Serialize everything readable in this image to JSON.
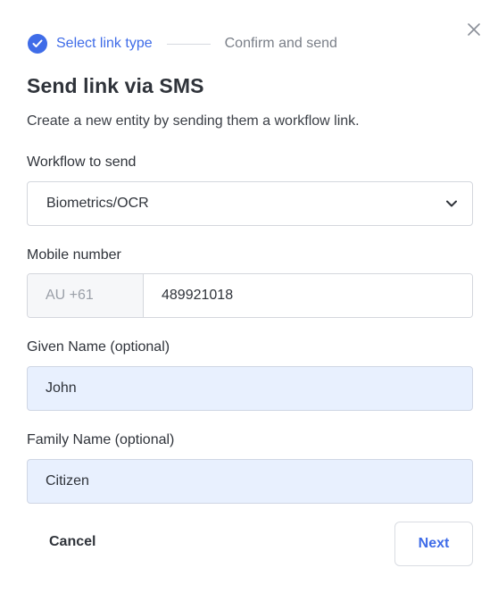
{
  "stepper": {
    "step_1_label": "Select link type",
    "step_2_label": "Confirm and send",
    "completed_icon": "check-circle-icon"
  },
  "title": "Send link via SMS",
  "subtitle": "Create a new entity by sending them a workflow link.",
  "workflow": {
    "label": "Workflow to send",
    "value": "Biometrics/OCR",
    "icon": "chevron-down-icon"
  },
  "mobile": {
    "label": "Mobile number",
    "prefix": "AU +61",
    "value": "489921018"
  },
  "given_name": {
    "label": "Given Name (optional)",
    "value": "John"
  },
  "family_name": {
    "label": "Family Name (optional)",
    "value": "Citizen"
  },
  "actions": {
    "cancel_label": "Cancel",
    "next_label": "Next"
  },
  "close_icon": "close-icon",
  "colors": {
    "accent": "#3f6ce8",
    "autofill_background": "#e8f0fe",
    "text": "#2f333a",
    "muted": "#7a7f88"
  }
}
